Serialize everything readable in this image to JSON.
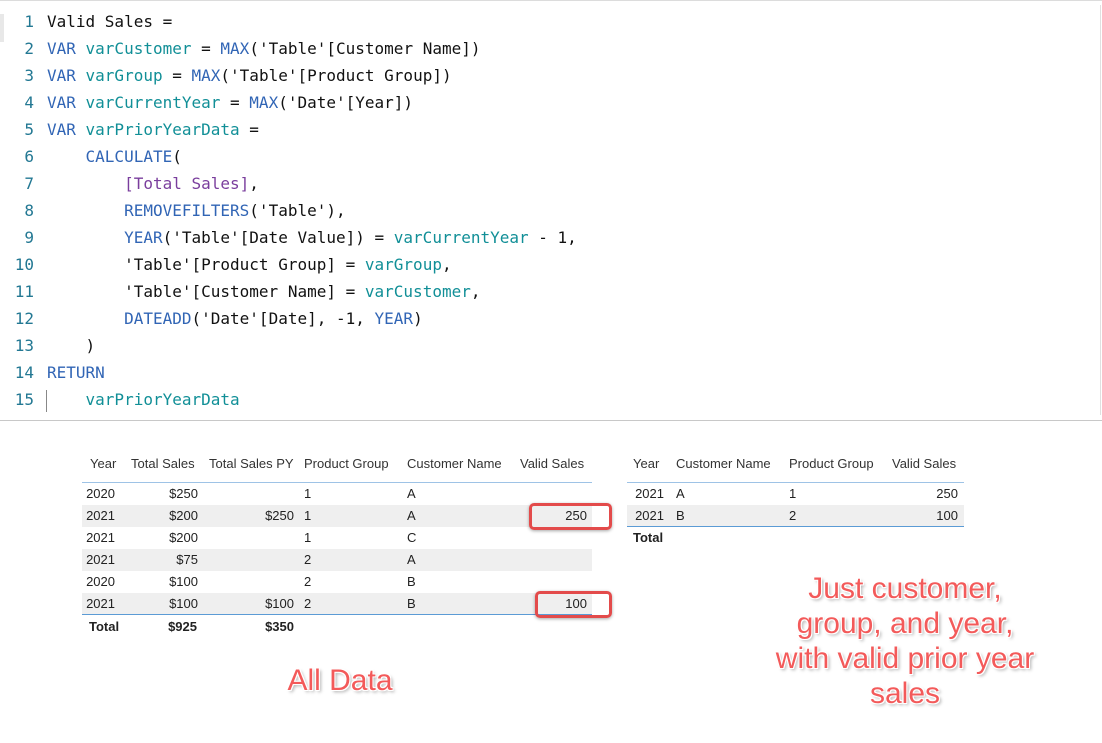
{
  "code": {
    "lines": [
      {
        "num": "1",
        "t": [
          [
            "plain",
            "Valid Sales ="
          ]
        ]
      },
      {
        "num": "2",
        "t": [
          [
            "kw",
            "VAR "
          ],
          [
            "var",
            "varCustomer"
          ],
          [
            "plain",
            " = "
          ],
          [
            "fn",
            "MAX"
          ],
          [
            "plain",
            "('Table'[Customer Name])"
          ]
        ]
      },
      {
        "num": "3",
        "t": [
          [
            "kw",
            "VAR "
          ],
          [
            "var",
            "varGroup"
          ],
          [
            "plain",
            " = "
          ],
          [
            "fn",
            "MAX"
          ],
          [
            "plain",
            "('Table'[Product Group])"
          ]
        ]
      },
      {
        "num": "4",
        "t": [
          [
            "kw",
            "VAR "
          ],
          [
            "var",
            "varCurrentYear"
          ],
          [
            "plain",
            " = "
          ],
          [
            "fn",
            "MAX"
          ],
          [
            "plain",
            "('Date'[Year])"
          ]
        ]
      },
      {
        "num": "5",
        "t": [
          [
            "kw",
            "VAR "
          ],
          [
            "var",
            "varPriorYearData"
          ],
          [
            "plain",
            " ="
          ]
        ]
      },
      {
        "num": "6",
        "t": [
          [
            "plain",
            "    "
          ],
          [
            "fn",
            "CALCULATE"
          ],
          [
            "plain",
            "("
          ]
        ]
      },
      {
        "num": "7",
        "t": [
          [
            "plain",
            "        "
          ],
          [
            "meas",
            "[Total Sales]"
          ],
          [
            "plain",
            ","
          ]
        ]
      },
      {
        "num": "8",
        "t": [
          [
            "plain",
            "        "
          ],
          [
            "fn",
            "REMOVEFILTERS"
          ],
          [
            "plain",
            "('Table'),"
          ]
        ]
      },
      {
        "num": "9",
        "t": [
          [
            "plain",
            "        "
          ],
          [
            "fn",
            "YEAR"
          ],
          [
            "plain",
            "('Table'[Date Value]) = "
          ],
          [
            "var",
            "varCurrentYear"
          ],
          [
            "plain",
            " - 1,"
          ]
        ]
      },
      {
        "num": "10",
        "t": [
          [
            "plain",
            "        'Table'[Product Group] = "
          ],
          [
            "var",
            "varGroup"
          ],
          [
            "plain",
            ","
          ]
        ]
      },
      {
        "num": "11",
        "t": [
          [
            "plain",
            "        'Table'[Customer Name] = "
          ],
          [
            "var",
            "varCustomer"
          ],
          [
            "plain",
            ","
          ]
        ]
      },
      {
        "num": "12",
        "t": [
          [
            "plain",
            "        "
          ],
          [
            "fn",
            "DATEADD"
          ],
          [
            "plain",
            "('Date'[Date], -1, "
          ],
          [
            "kw",
            "YEAR"
          ],
          [
            "plain",
            ")"
          ]
        ]
      },
      {
        "num": "13",
        "t": [
          [
            "plain",
            "    )"
          ]
        ]
      },
      {
        "num": "14",
        "t": [
          [
            "kw",
            "RETURN"
          ]
        ]
      },
      {
        "num": "15",
        "t": [
          [
            "plain",
            "    "
          ],
          [
            "var",
            "varPriorYearData"
          ]
        ]
      }
    ]
  },
  "table1": {
    "headers": [
      "Year",
      "Total Sales",
      "Total Sales PY",
      "Product Group",
      "Customer Name",
      "Valid Sales"
    ],
    "rows": [
      [
        "2020",
        "$250",
        "",
        "1",
        "A",
        ""
      ],
      [
        "2021",
        "$200",
        "$250",
        "1",
        "A",
        "250"
      ],
      [
        "2021",
        "$200",
        "",
        "1",
        "C",
        ""
      ],
      [
        "2021",
        "$75",
        "",
        "2",
        "A",
        ""
      ],
      [
        "2020",
        "$100",
        "",
        "2",
        "B",
        ""
      ],
      [
        "2021",
        "$100",
        "$100",
        "2",
        "B",
        "100"
      ]
    ],
    "total": {
      "label": "Total",
      "total_sales": "$925",
      "total_sales_py": "$350"
    }
  },
  "table2": {
    "headers": [
      "Year",
      "Customer Name",
      "Product Group",
      "Valid Sales"
    ],
    "rows": [
      [
        "2021",
        "A",
        "1",
        "250"
      ],
      [
        "2021",
        "B",
        "2",
        "100"
      ]
    ],
    "total": {
      "label": "Total"
    }
  },
  "annotations": {
    "all_data": "All Data",
    "subset_lines": [
      "Just customer,",
      "group, and year,",
      "with valid prior year",
      "sales"
    ]
  },
  "colors": {
    "keyword": "#3165b5",
    "variable": "#118f97",
    "measure": "#7a3e9d",
    "line_number": "#237893",
    "highlight": "#e34b4b",
    "annotation": "#f35a5a",
    "table_rule": "#5b9bd5"
  }
}
